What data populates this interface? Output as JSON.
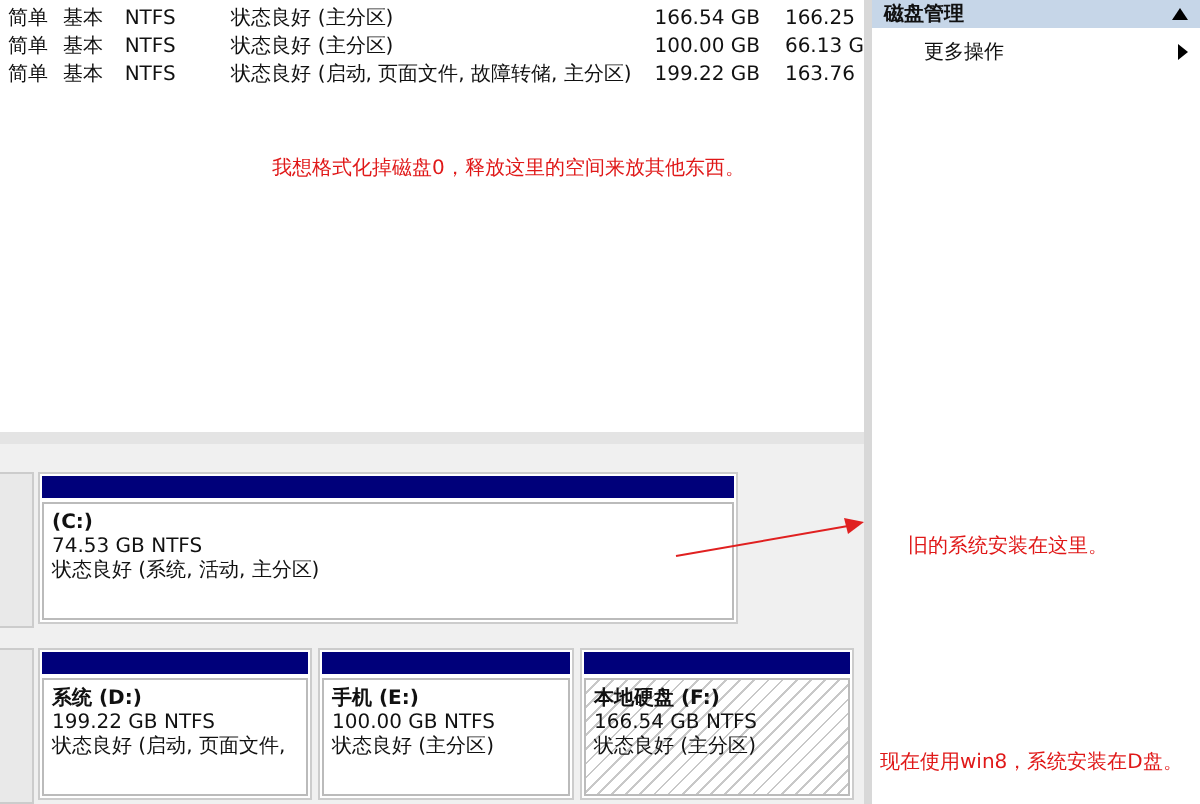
{
  "volume_table": {
    "rows": [
      {
        "cells": [
          "简单",
          "基本",
          "NTFS",
          "状态良好 (主分区)",
          "166.54 GB",
          "166.25"
        ]
      },
      {
        "cells": [
          "简单",
          "基本",
          "NTFS",
          "状态良好 (主分区)",
          "100.00 GB",
          "66.13 G"
        ]
      },
      {
        "cells": [
          "简单",
          "基本",
          "NTFS",
          "状态良好 (启动, 页面文件, 故障转储, 主分区)",
          "199.22 GB",
          "163.76"
        ]
      }
    ]
  },
  "note_top": "我想格式化掉磁盘0，释放这里的空间来放其他东西。",
  "disks": [
    {
      "partitions": [
        {
          "name": "(C:)",
          "size": "74.53 GB NTFS",
          "status": "状态良好 (系统, 活动, 主分区)",
          "selected": false
        }
      ]
    },
    {
      "partitions": [
        {
          "name": "系统  (D:)",
          "size": "199.22 GB NTFS",
          "status": "状态良好 (启动, 页面文件,",
          "selected": false
        },
        {
          "name": "手机  (E:)",
          "size": "100.00 GB NTFS",
          "status": "状态良好 (主分区)",
          "selected": false
        },
        {
          "name": "本地硬盘  (F:)",
          "size": "166.54 GB NTFS",
          "status": "状态良好 (主分区)",
          "selected": true
        }
      ]
    }
  ],
  "actions": {
    "header": "磁盘管理",
    "items": [
      {
        "label": "更多操作"
      }
    ]
  },
  "note_right": "旧的系统安装在这里。",
  "note_bottom": "现在使用win8，系统安装在D盘。"
}
